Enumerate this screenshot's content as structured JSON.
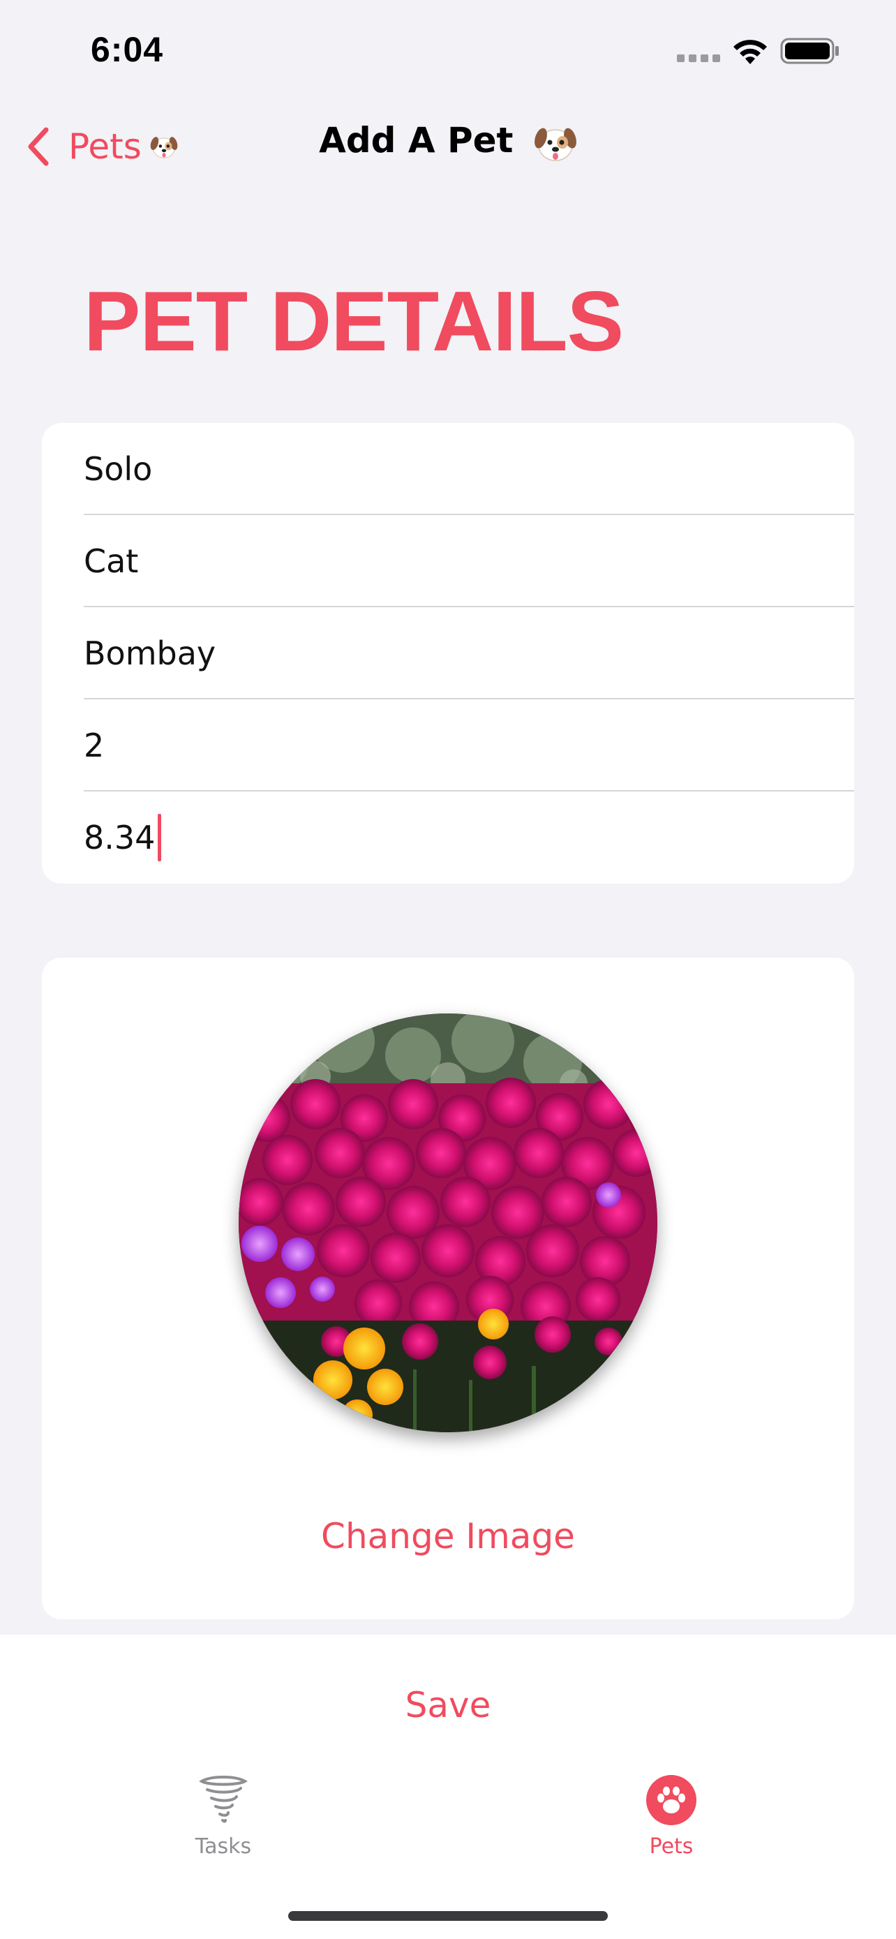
{
  "status_bar": {
    "time": "6:04"
  },
  "nav": {
    "back_label": "Pets",
    "title": "Add A Pet"
  },
  "page": {
    "heading": "PET DETAILS"
  },
  "form": {
    "fields": [
      {
        "value": "Solo"
      },
      {
        "value": "Cat"
      },
      {
        "value": "Bombay"
      },
      {
        "value": "2"
      },
      {
        "value": "8.34"
      }
    ]
  },
  "image_section": {
    "change_image_label": "Change Image"
  },
  "actions": {
    "save_label": "Save"
  },
  "tab_bar": {
    "tabs": [
      {
        "label": "Tasks",
        "icon": "tornado-icon",
        "active": false
      },
      {
        "label": "Pets",
        "icon": "paw-icon",
        "active": true
      }
    ]
  },
  "colors": {
    "accent": "#F04B5E",
    "background": "#F2F2F7",
    "card": "#FFFFFF",
    "inactive": "#8E8E93"
  }
}
